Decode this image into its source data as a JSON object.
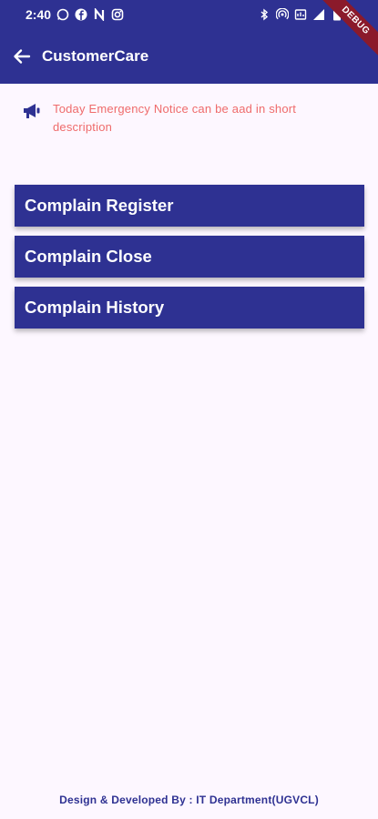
{
  "status_bar": {
    "time": "2:40",
    "left_icons": [
      "whatsapp-icon",
      "facebook-icon",
      "n-app-icon",
      "instagram-icon"
    ],
    "right_icons": [
      "bluetooth-icon",
      "hotspot-icon",
      "data-saver-icon",
      "signal-icon",
      "battery-icon"
    ]
  },
  "app_bar": {
    "title": "CustomerCare",
    "back_icon": "arrow-left-icon",
    "debug_banner": "DEBUG",
    "color": "#2e3192"
  },
  "notice": {
    "icon": "megaphone-icon",
    "text": "Today Emergency Notice can be aad in short description",
    "color": "#ef6b6b"
  },
  "menu": {
    "items": [
      {
        "label": "Complain Register"
      },
      {
        "label": "Complain Close"
      },
      {
        "label": "Complain History"
      }
    ]
  },
  "footer": {
    "text": "Design & Developed By : IT Department(UGVCL)"
  }
}
